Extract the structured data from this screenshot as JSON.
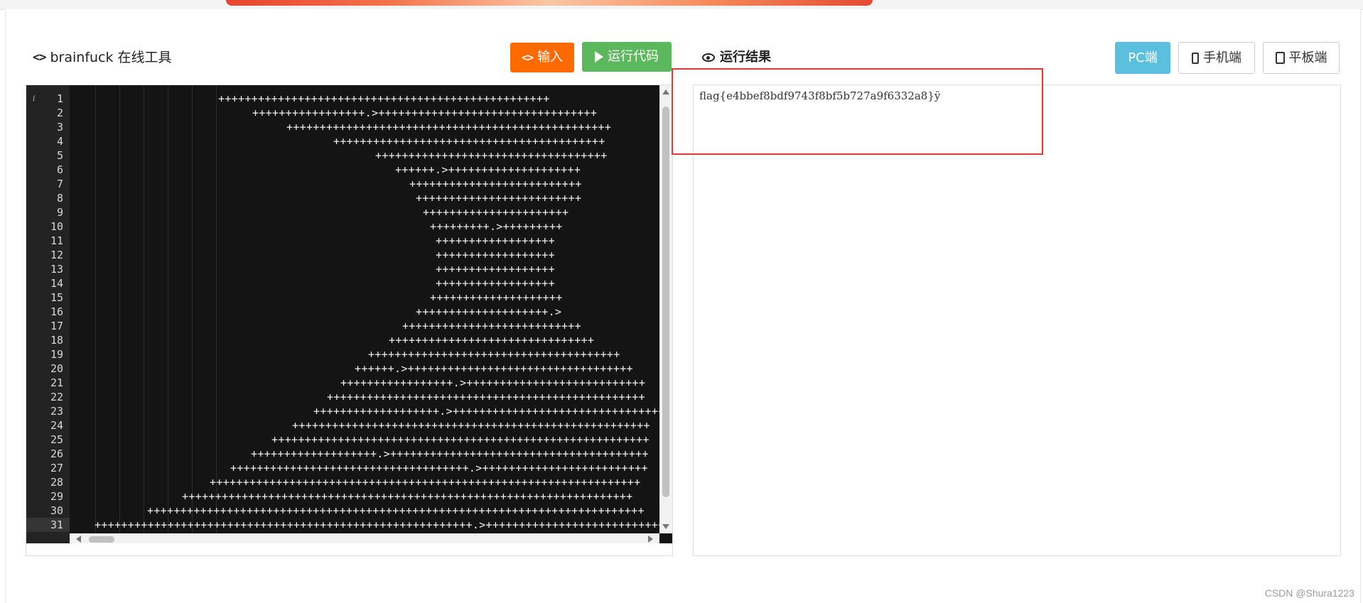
{
  "tool": {
    "icon": "code-icon",
    "title": "brainfuck 在线工具"
  },
  "toolbar": {
    "input_label": "输入",
    "run_label": "运行代码"
  },
  "result": {
    "title": "运行结果",
    "devices": {
      "pc": "PC端",
      "phone": "手机端",
      "tablet": "平板端"
    },
    "output": "flag{e4bbef8bdf9743f8bf5b727a9f6332a8}ÿ"
  },
  "editor": {
    "info_glyph": "i",
    "line_numbers": [
      "1",
      "2",
      "3",
      "4",
      "5",
      "6",
      "7",
      "8",
      "9",
      "10",
      "11",
      "12",
      "13",
      "14",
      "15",
      "16",
      "17",
      "18",
      "19",
      "20",
      "21",
      "22",
      "23",
      "24",
      "25",
      "26",
      "27",
      "28",
      "29",
      "30",
      "31"
    ],
    "lines": [
      "++++++++++++++++++++++++++++++++++++++++++++++++++",
      "+++++++++++++++++.>+++++++++++++++++++++++++++++++++",
      "+++++++++++++++++++++++++++++++++++++++++++++++++",
      "+++++++++++++++++++++++++++++++++++++++++",
      "+++++++++++++++++++++++++++++++++++",
      "++++++.>++++++++++++++++++++",
      "++++++++++++++++++++++++++",
      "+++++++++++++++++++++++++",
      "++++++++++++++++++++++",
      "+++++++++.>+++++++++",
      "++++++++++++++++++",
      "++++++++++++++++++",
      "++++++++++++++++++",
      "++++++++++++++++++",
      "++++++++++++++++++++",
      "++++++++++++++++++++.>",
      "+++++++++++++++++++++++++++",
      "+++++++++++++++++++++++++++++++",
      "++++++++++++++++++++++++++++++++++++++",
      "++++++.>++++++++++++++++++++++++++++++++++",
      "+++++++++++++++++.>+++++++++++++++++++++++++++",
      "++++++++++++++++++++++++++++++++++++++++++++++++",
      "+++++++++++++++++++.>++++++++++++++++++++++++++++++++",
      "++++++++++++++++++++++++++++++++++++++++++++++++++++++",
      "+++++++++++++++++++++++++++++++++++++++++++++++++++++++++",
      "+++++++++++++++++++.>+++++++++++++++++++++++++++++++++++++++",
      "++++++++++++++++++++++++++++++++++++.>+++++++++++++++++++++++++",
      "+++++++++++++++++++++++++++++++++++++++++++++++++++++++++++++++++",
      "++++++++++++++++++++++++++++++++++++++++++++++++++++++++++++++++++++",
      "+++++++++++++++++++++++++++++++++++++++++++++++++++++++++++++++++++++++++++",
      "+++++++++++++++++++++++++++++++++++++++++++++++++++++++++.>++++++++++++++++++++++++++++++++++++++++++++"
    ]
  },
  "watermark": "CSDN @Shura1223"
}
